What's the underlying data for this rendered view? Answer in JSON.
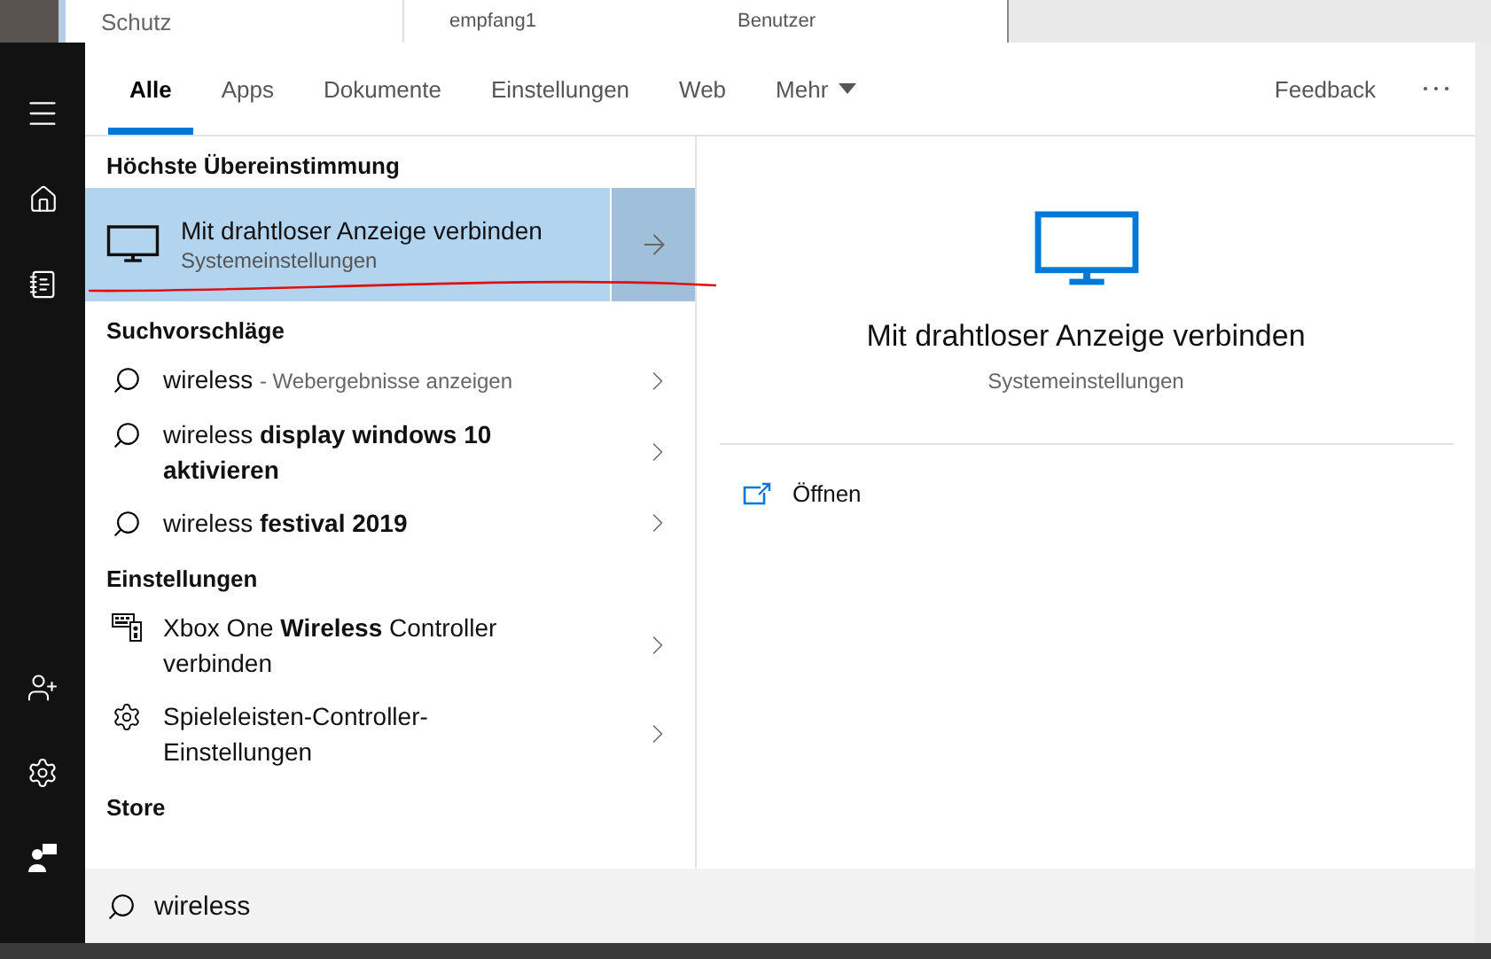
{
  "background": {
    "left_window_text": "Schutz",
    "table_cells": [
      "empfang1",
      "Benutzer"
    ]
  },
  "tabs": [
    {
      "label": "Alle",
      "selected": true,
      "kind": "plain"
    },
    {
      "label": "Apps",
      "selected": false,
      "kind": "plain"
    },
    {
      "label": "Dokumente",
      "selected": false,
      "kind": "plain"
    },
    {
      "label": "Einstellungen",
      "selected": false,
      "kind": "plain"
    },
    {
      "label": "Web",
      "selected": false,
      "kind": "plain"
    },
    {
      "label": "Mehr",
      "selected": false,
      "kind": "dropdown"
    }
  ],
  "feedback": "Feedback",
  "best_match": {
    "heading": "Höchste Übereinstimmung",
    "title": "Mit drahtloser Anzeige verbinden",
    "subtitle": "Systemeinstellungen",
    "selected": true
  },
  "sections": [
    {
      "heading": "Suchvorschläge",
      "items": [
        {
          "kind": "search",
          "text": "wireless",
          "hint": "- Webergebnisse anzeigen"
        },
        {
          "kind": "search",
          "text": "wireless **display windows 10 aktivieren**"
        },
        {
          "kind": "search",
          "text": "wireless **festival 2019**"
        }
      ]
    },
    {
      "heading": "Einstellungen",
      "items": [
        {
          "kind": "controller",
          "text": "Xbox One **Wireless** Controller verbinden"
        },
        {
          "kind": "gear",
          "text": "Spieleleisten-Controller-Einstellungen"
        }
      ]
    },
    {
      "heading": "Store"
    }
  ],
  "preview": {
    "title": "Mit drahtloser Anzeige verbinden",
    "subtitle": "Systemeinstellungen",
    "actions": [
      {
        "label": "Öffnen"
      }
    ]
  },
  "search": {
    "value": "wireless"
  }
}
